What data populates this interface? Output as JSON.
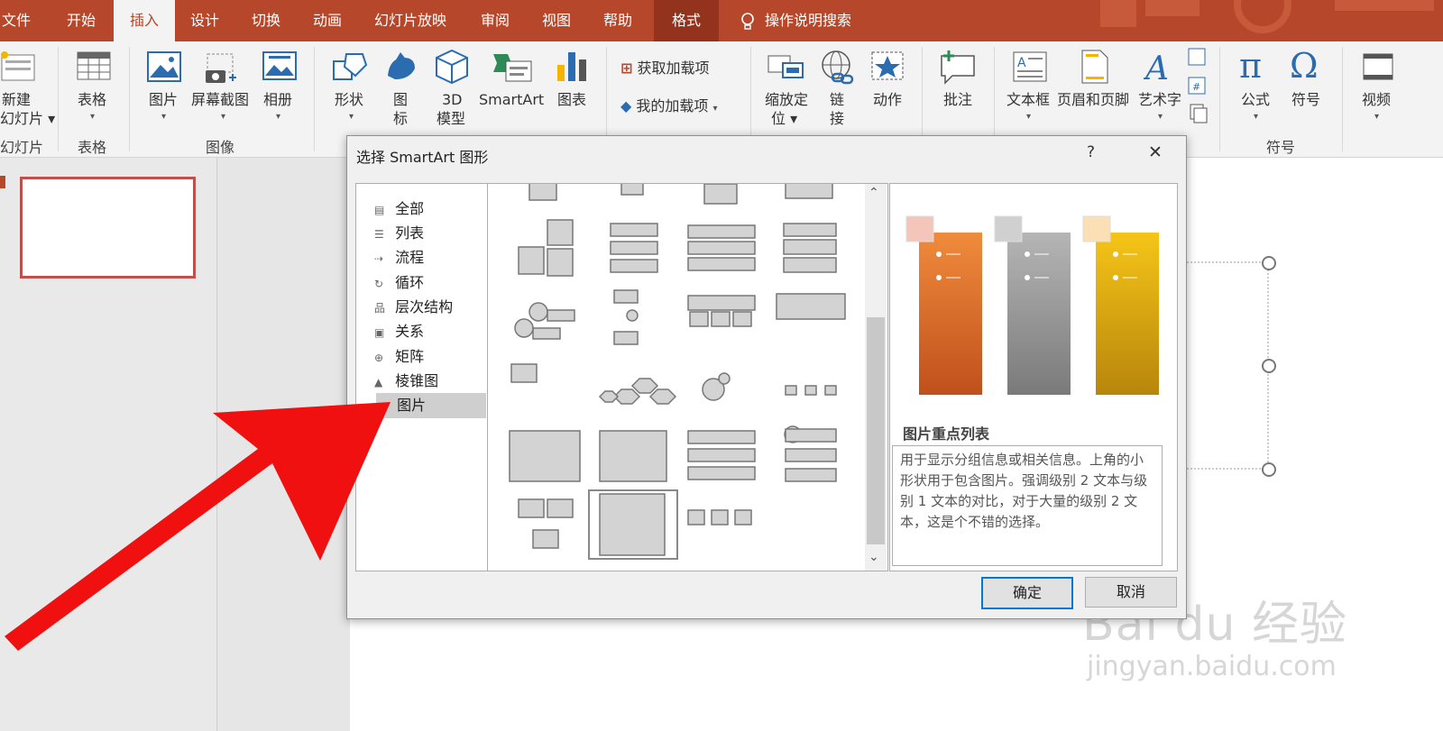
{
  "menu": {
    "tabs": [
      "文件",
      "开始",
      "插入",
      "设计",
      "切换",
      "动画",
      "幻灯片放映",
      "审阅",
      "视图",
      "帮助",
      "格式"
    ],
    "active": "插入",
    "search_label": "操作说明搜索"
  },
  "ribbon": {
    "new_slide": [
      "新建",
      "幻灯片"
    ],
    "table": "表格",
    "picture": "图片",
    "screenshot": "屏幕截图",
    "album": "相册",
    "shapes": "形状",
    "icons": [
      "图",
      "标"
    ],
    "model3d": [
      "3D",
      "模型"
    ],
    "smartart": "SmartArt",
    "chart": "图表",
    "get_addins": "获取加载项",
    "my_addins": "我的加载项",
    "zoom": [
      "缩放定",
      "位"
    ],
    "link": [
      "链",
      "接"
    ],
    "action": "动作",
    "comment": "批注",
    "textbox": "文本框",
    "header_footer": "页眉和页脚",
    "wordart": "艺术字",
    "equation": "公式",
    "symbol": "符号",
    "video": "视频",
    "groups": {
      "slides": "幻灯片",
      "tables": "表格",
      "images": "图像",
      "symbols": "符号"
    }
  },
  "dialog": {
    "title": "选择 SmartArt 图形",
    "help": "?",
    "close": "✕",
    "categories": [
      {
        "label": "全部",
        "icon": "all-icon"
      },
      {
        "label": "列表",
        "icon": "list-icon"
      },
      {
        "label": "流程",
        "icon": "process-icon"
      },
      {
        "label": "循环",
        "icon": "cycle-icon"
      },
      {
        "label": "层次结构",
        "icon": "hierarchy-icon"
      },
      {
        "label": "关系",
        "icon": "relationship-icon"
      },
      {
        "label": "矩阵",
        "icon": "matrix-icon"
      },
      {
        "label": "棱锥图",
        "icon": "pyramid-icon"
      },
      {
        "label": "图片",
        "icon": "picture-icon"
      }
    ],
    "selected_category": "图片",
    "preview_title": "图片重点列表",
    "preview_description": "用于显示分组信息或相关信息。上角的小形状用于包含图片。强调级别 2 文本与级别 1 文本的对比，对于大量的级别 2 文本，这是个不错的选择。",
    "ok": "确定",
    "cancel": "取消",
    "preview_colors": {
      "bar1_top": "#f08b3c",
      "bar1_bottom": "#c0501c",
      "bar2_top": "#b5b5b5",
      "bar2_bottom": "#7a7a7a",
      "bar3_top": "#f5c518",
      "bar3_bottom": "#b8860b"
    }
  },
  "watermark": {
    "brand": "Bai du 经验",
    "url": "jingyan.baidu.com"
  },
  "colors": {
    "accent": "#b7472a",
    "arrow": "#f01010"
  }
}
